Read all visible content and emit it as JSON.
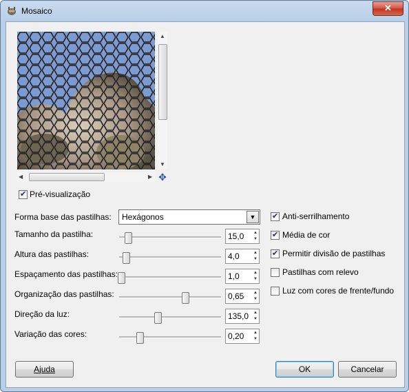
{
  "window": {
    "title": "Mosaico",
    "close_glyph": "✕"
  },
  "preview": {
    "checkbox_label": "Pré-visualização",
    "checked": true
  },
  "form": {
    "tile_geometry_label": "Forma base das pastilhas:",
    "tile_geometry_value": "Hexágonos",
    "sliders": [
      {
        "label": "Tamanho da pastilha:",
        "value": "15,0",
        "fraction": 0.09
      },
      {
        "label": "Altura das pastilhas:",
        "value": "4,0",
        "fraction": 0.07
      },
      {
        "label": "Espaçamento das pastilhas:",
        "value": "1,0",
        "fraction": 0.02
      },
      {
        "label": "Organização das pastilhas:",
        "value": "0,65",
        "fraction": 0.65
      },
      {
        "label": "Direção da luz:",
        "value": "135,0",
        "fraction": 0.375
      },
      {
        "label": "Variação das cores:",
        "value": "0,20",
        "fraction": 0.2
      }
    ]
  },
  "options": [
    {
      "label": "Anti-serrilhamento",
      "checked": true
    },
    {
      "label": "Média de cor",
      "checked": true
    },
    {
      "label": "Permitir divisão de pastilhas",
      "checked": true
    },
    {
      "label": "Pastilhas com relevo",
      "checked": false
    },
    {
      "label": "Luz com cores de frente/fundo",
      "checked": false
    }
  ],
  "buttons": {
    "help": "Ajuda",
    "ok": "OK",
    "cancel": "Cancelar"
  },
  "icons": {
    "app": "gimp-icon",
    "move": "move-arrows-icon"
  }
}
